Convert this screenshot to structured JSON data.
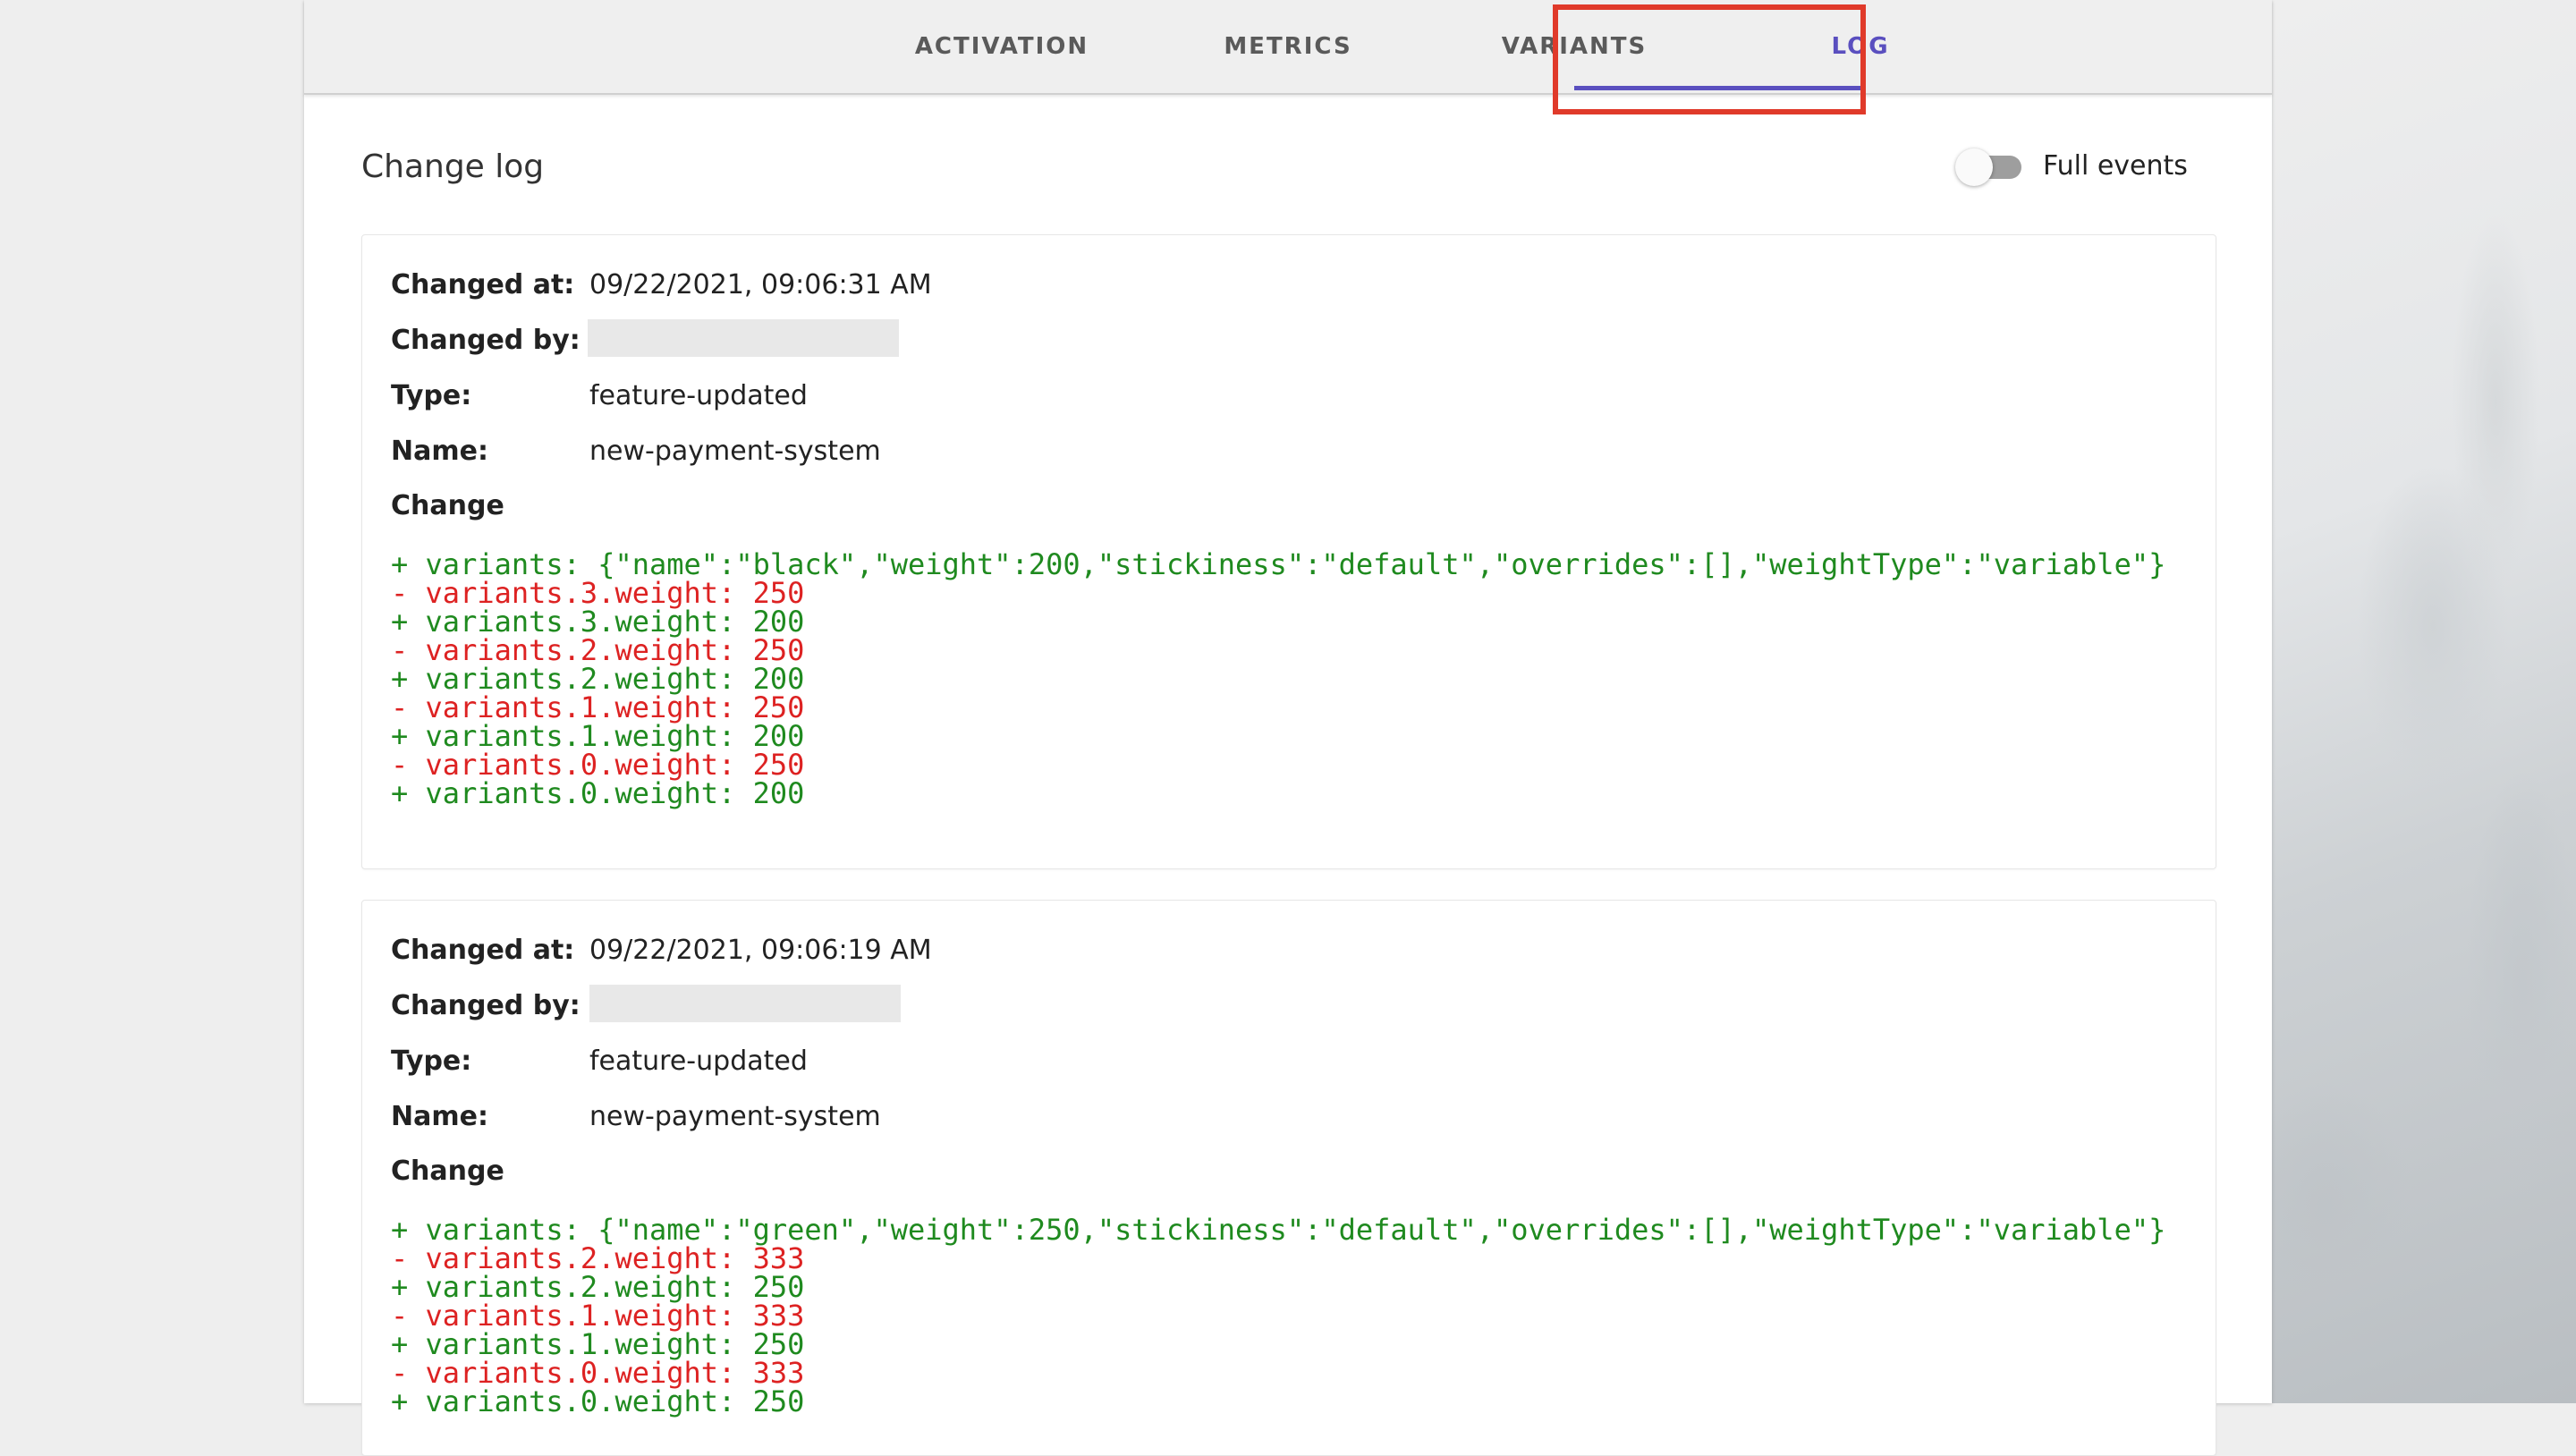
{
  "tabs": [
    "ACTIVATION",
    "METRICS",
    "VARIANTS",
    "LOG"
  ],
  "active_tab": "LOG",
  "colors": {
    "accent": "#5a4fbf",
    "added": "#1f8a1f",
    "removed": "#dd2222",
    "highlight": "#e03a2a"
  },
  "header": {
    "title": "Change log",
    "toggle_label": "Full events",
    "toggle_on": false
  },
  "labels": {
    "changed_at": "Changed at:",
    "changed_by": "Changed by:",
    "type": "Type:",
    "name": "Name:",
    "change": "Change"
  },
  "events": [
    {
      "changed_at": "09/22/2021, 09:06:31 AM",
      "changed_by": "",
      "type": "feature-updated",
      "name": "new-payment-system",
      "diff": [
        {
          "op": "+",
          "text": "+ variants: {\"name\":\"black\",\"weight\":200,\"stickiness\":\"default\",\"overrides\":[],\"weightType\":\"variable\"}"
        },
        {
          "op": "-",
          "text": "- variants.3.weight: 250"
        },
        {
          "op": "+",
          "text": "+ variants.3.weight: 200"
        },
        {
          "op": "-",
          "text": "- variants.2.weight: 250"
        },
        {
          "op": "+",
          "text": "+ variants.2.weight: 200"
        },
        {
          "op": "-",
          "text": "- variants.1.weight: 250"
        },
        {
          "op": "+",
          "text": "+ variants.1.weight: 200"
        },
        {
          "op": "-",
          "text": "- variants.0.weight: 250"
        },
        {
          "op": "+",
          "text": "+ variants.0.weight: 200"
        }
      ]
    },
    {
      "changed_at": "09/22/2021, 09:06:19 AM",
      "changed_by": "",
      "type": "feature-updated",
      "name": "new-payment-system",
      "diff": [
        {
          "op": "+",
          "text": "+ variants: {\"name\":\"green\",\"weight\":250,\"stickiness\":\"default\",\"overrides\":[],\"weightType\":\"variable\"}"
        },
        {
          "op": "-",
          "text": "- variants.2.weight: 333"
        },
        {
          "op": "+",
          "text": "+ variants.2.weight: 250"
        },
        {
          "op": "-",
          "text": "- variants.1.weight: 333"
        },
        {
          "op": "+",
          "text": "+ variants.1.weight: 250"
        },
        {
          "op": "-",
          "text": "- variants.0.weight: 333"
        },
        {
          "op": "+",
          "text": "+ variants.0.weight: 250"
        }
      ]
    }
  ]
}
